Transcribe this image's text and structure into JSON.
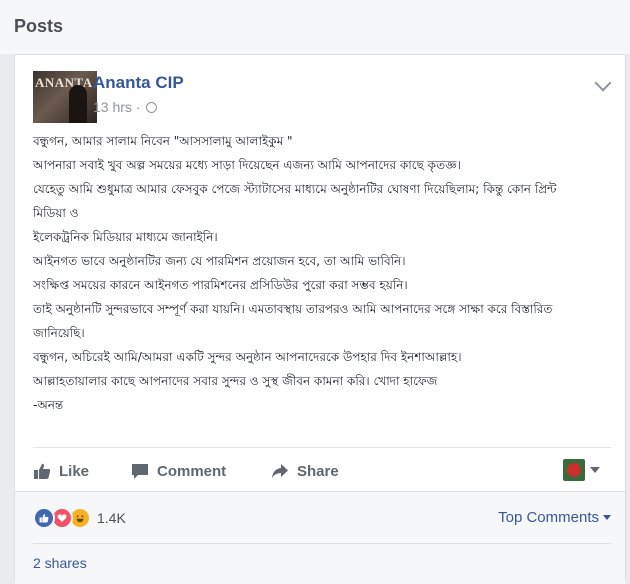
{
  "header": {
    "title": "Posts"
  },
  "post": {
    "author": "Ananta CIP",
    "avatar_logo_text": "ANANTA",
    "timestamp": "13 hrs ·",
    "privacy_icon": "globe-icon",
    "options_icon": "chevron-down-icon",
    "text_lines": [
      "বন্ধুগন, আমার সালাম নিবেন \"আসসালামু আলাইকুম \"",
      "আপনারা সবাই খুব অল্প সময়ের মধ্যে সাড়া দিয়েছেন এজন্য আমি আপনাদের কাছে কৃতজ্ঞ।",
      "যেহেতু আমি শুধুমাত্র আমার ফেসবুক পেজে স্ট্যাটাসের মাধ্যমে অনুষ্ঠানটির ঘোষণা দিয়েছিলাম; কিন্তু কোন প্রিন্ট",
      "মিডিয়া ও",
      "ইলেকট্রনিক মিডিয়ার মাধ্যমে জানাইনি।",
      "আইনগত ভাবে অনুষ্ঠানটির জন্য যে পারমিশন প্রয়োজন হবে, তা আমি ভাবিনি।",
      "সংক্ষিপ্ত সময়ের কারনে আইনগত পারমিশনের প্রসিডিউর পুরো করা সম্ভব হয়নি।",
      "তাই অনুষ্ঠানটি সুন্দরভাবে সম্পূর্ণ করা যায়নি। এমতাবস্থায় তারপরও আমি আপনাদের সঙ্গে সাক্ষা করে বিস্তারিত",
      "জানিয়েছি।",
      "বন্ধুগন, অচিরেই আমি/আমরা একটি সুন্দর অনুষ্ঠান আপনাদেরকে উপহার দিব ইনশাআল্লাহ।",
      "আল্লাহতায়ালার কাছে আপনাদের সবার সুন্দর ও সুস্থ জীবন কামনা করি। খোদা হাফেজ",
      "-অনন্ত"
    ]
  },
  "actions": {
    "like_label": "Like",
    "comment_label": "Comment",
    "share_label": "Share"
  },
  "footer": {
    "reaction_count": "1.4K",
    "reaction_icons": [
      "like-reaction-icon",
      "love-reaction-icon",
      "haha-reaction-icon"
    ],
    "sort_label": "Top Comments",
    "shares_label": "2 shares"
  },
  "colors": {
    "link_blue": "#365899",
    "like_blue": "#4267b2",
    "love_red": "#f25268",
    "haha_yellow": "#f7b125"
  }
}
